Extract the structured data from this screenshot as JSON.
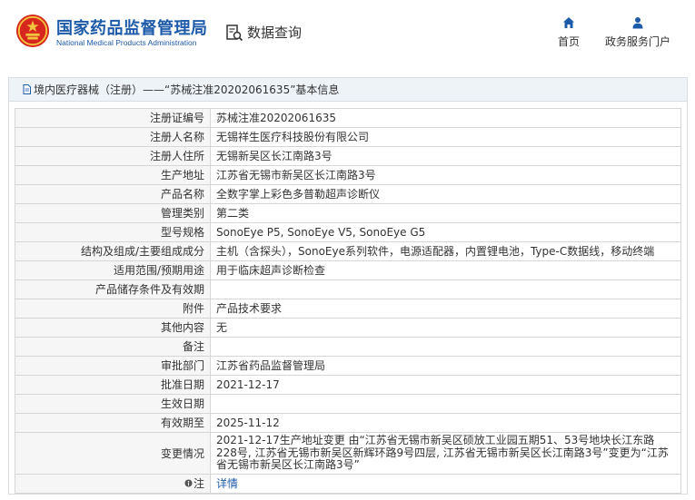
{
  "header": {
    "site_name_cn": "国家药品监督管理局",
    "site_name_en": "National Medical Products Administration",
    "query_label": "数据查询",
    "nav": {
      "home": "首页",
      "gov_service": "政务服务门户"
    },
    "colors": {
      "brand_blue": "#1d5aa8",
      "emblem_red": "#d7261e",
      "emblem_gold": "#f2c33c"
    }
  },
  "page": {
    "title": "境内医疗器械（注册）——“苏械注准20202061635”基本信息"
  },
  "details": [
    {
      "label": "注册证编号",
      "value": "苏械注准20202061635"
    },
    {
      "label": "注册人名称",
      "value": "无锡祥生医疗科技股份有限公司"
    },
    {
      "label": "注册人住所",
      "value": "无锡新吴区长江南路3号"
    },
    {
      "label": "生产地址",
      "value": "江苏省无锡市新吴区长江南路3号"
    },
    {
      "label": "产品名称",
      "value": "全数字掌上彩色多普勒超声诊断仪"
    },
    {
      "label": "管理类别",
      "value": "第二类"
    },
    {
      "label": "型号规格",
      "value": "SonoEye P5, SonoEye V5, SonoEye G5"
    },
    {
      "label": "结构及组成/主要组成成分",
      "value": "主机（含探头），SonoEye系列软件，电源适配器，内置锂电池，Type-C数据线，移动终端"
    },
    {
      "label": "适用范围/预期用途",
      "value": "用于临床超声诊断检查"
    },
    {
      "label": "产品储存条件及有效期",
      "value": ""
    },
    {
      "label": "附件",
      "value": "产品技术要求"
    },
    {
      "label": "其他内容",
      "value": "无"
    },
    {
      "label": "备注",
      "value": ""
    },
    {
      "label": "审批部门",
      "value": "江苏省药品监督管理局"
    },
    {
      "label": "批准日期",
      "value": "2021-12-17"
    },
    {
      "label": "生效日期",
      "value": ""
    },
    {
      "label": "有效期至",
      "value": "2025-11-12"
    },
    {
      "label": "变更情况",
      "value": "2021-12-17生产地址变更 由“江苏省无锡市新吴区硕放工业园五期51、53号地块长江东路228号, 江苏省无锡市新吴区新辉环路9号四层, 江苏省无锡市新吴区长江南路3号”变更为“江苏省无锡市新吴区长江南路3号”"
    }
  ],
  "note": {
    "label": "注",
    "icon": "info-bullet-icon",
    "link_text": "详情"
  }
}
